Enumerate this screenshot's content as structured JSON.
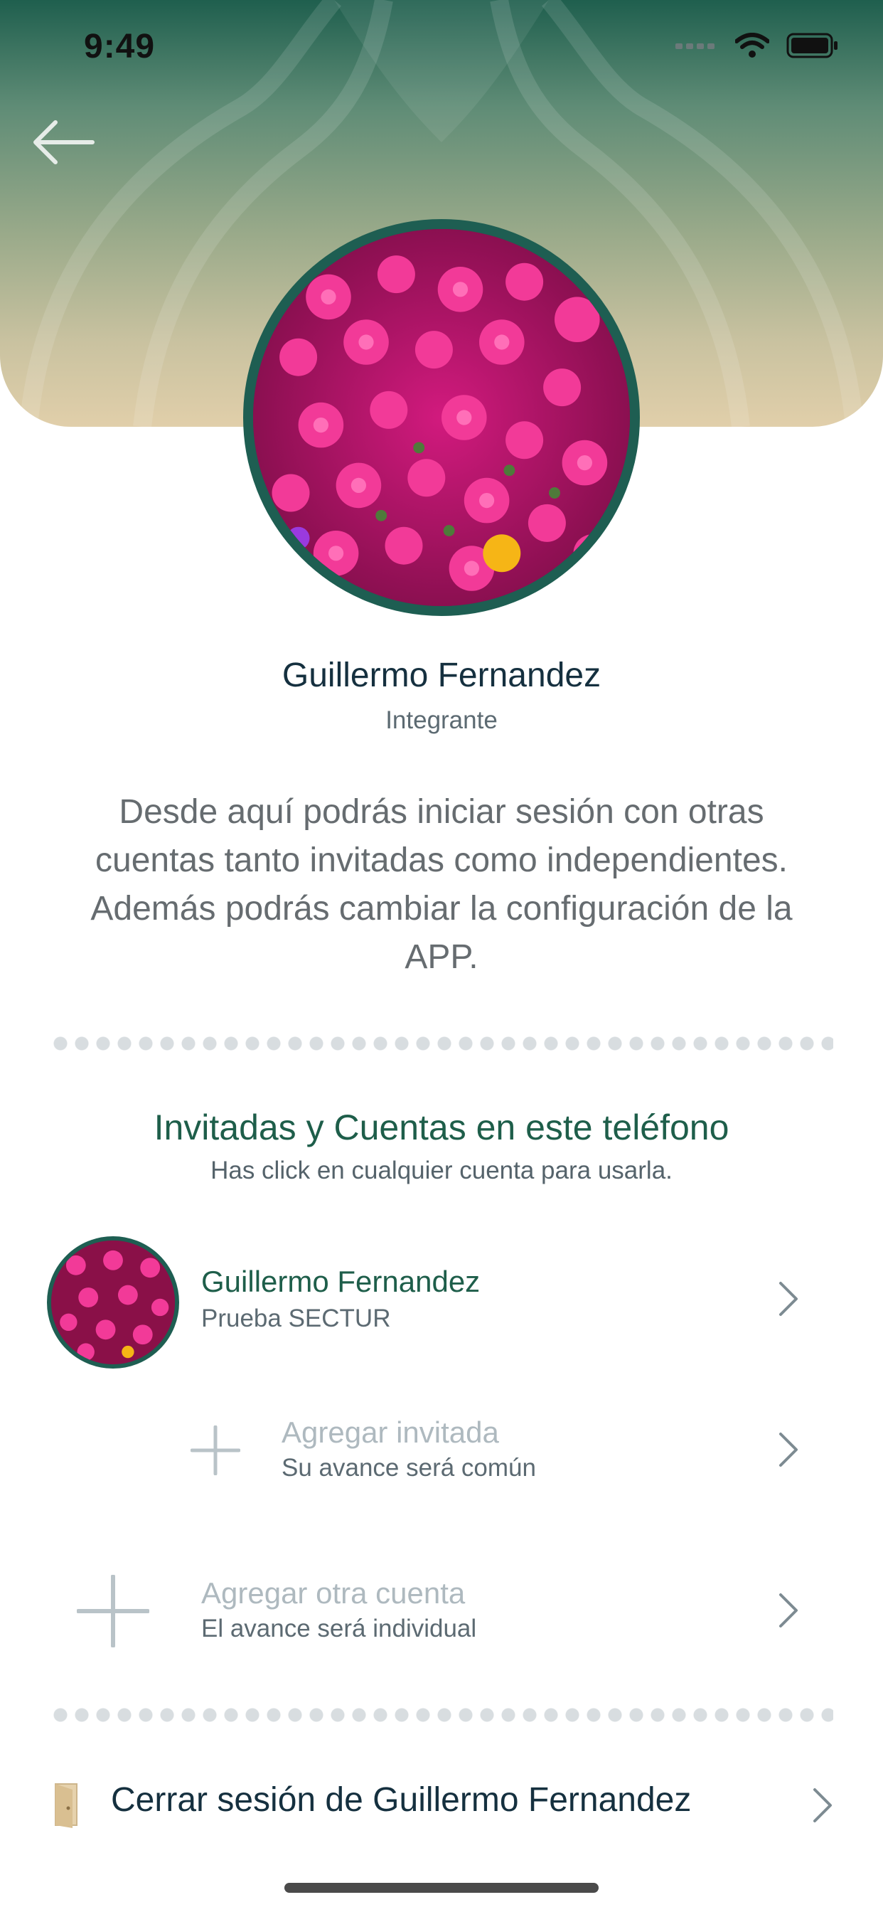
{
  "status_bar": {
    "time": "9:49"
  },
  "profile": {
    "name": "Guillermo Fernandez",
    "role": "Integrante",
    "description": "Desde aquí podrás iniciar sesión con otras cuentas tanto invitadas como independientes. Además podrás cambiar la configuración de la APP."
  },
  "accounts_section": {
    "title": "Invitadas y Cuentas en este teléfono",
    "subtitle": "Has click en cualquier cuenta para usarla."
  },
  "accounts": [
    {
      "name": "Guillermo Fernandez",
      "detail": "Prueba SECTUR"
    }
  ],
  "add_guest": {
    "title": "Agregar invitada",
    "subtitle": "Su avance será común"
  },
  "add_account": {
    "title": "Agregar otra cuenta",
    "subtitle": "El avance será individual"
  },
  "logout": {
    "label": "Cerrar sesión de Guillermo Fernandez"
  },
  "colors": {
    "primary_green": "#1e5e4a",
    "text_dark": "#15303f",
    "muted": "#aeb9bf",
    "divider": "#d8dde0"
  }
}
